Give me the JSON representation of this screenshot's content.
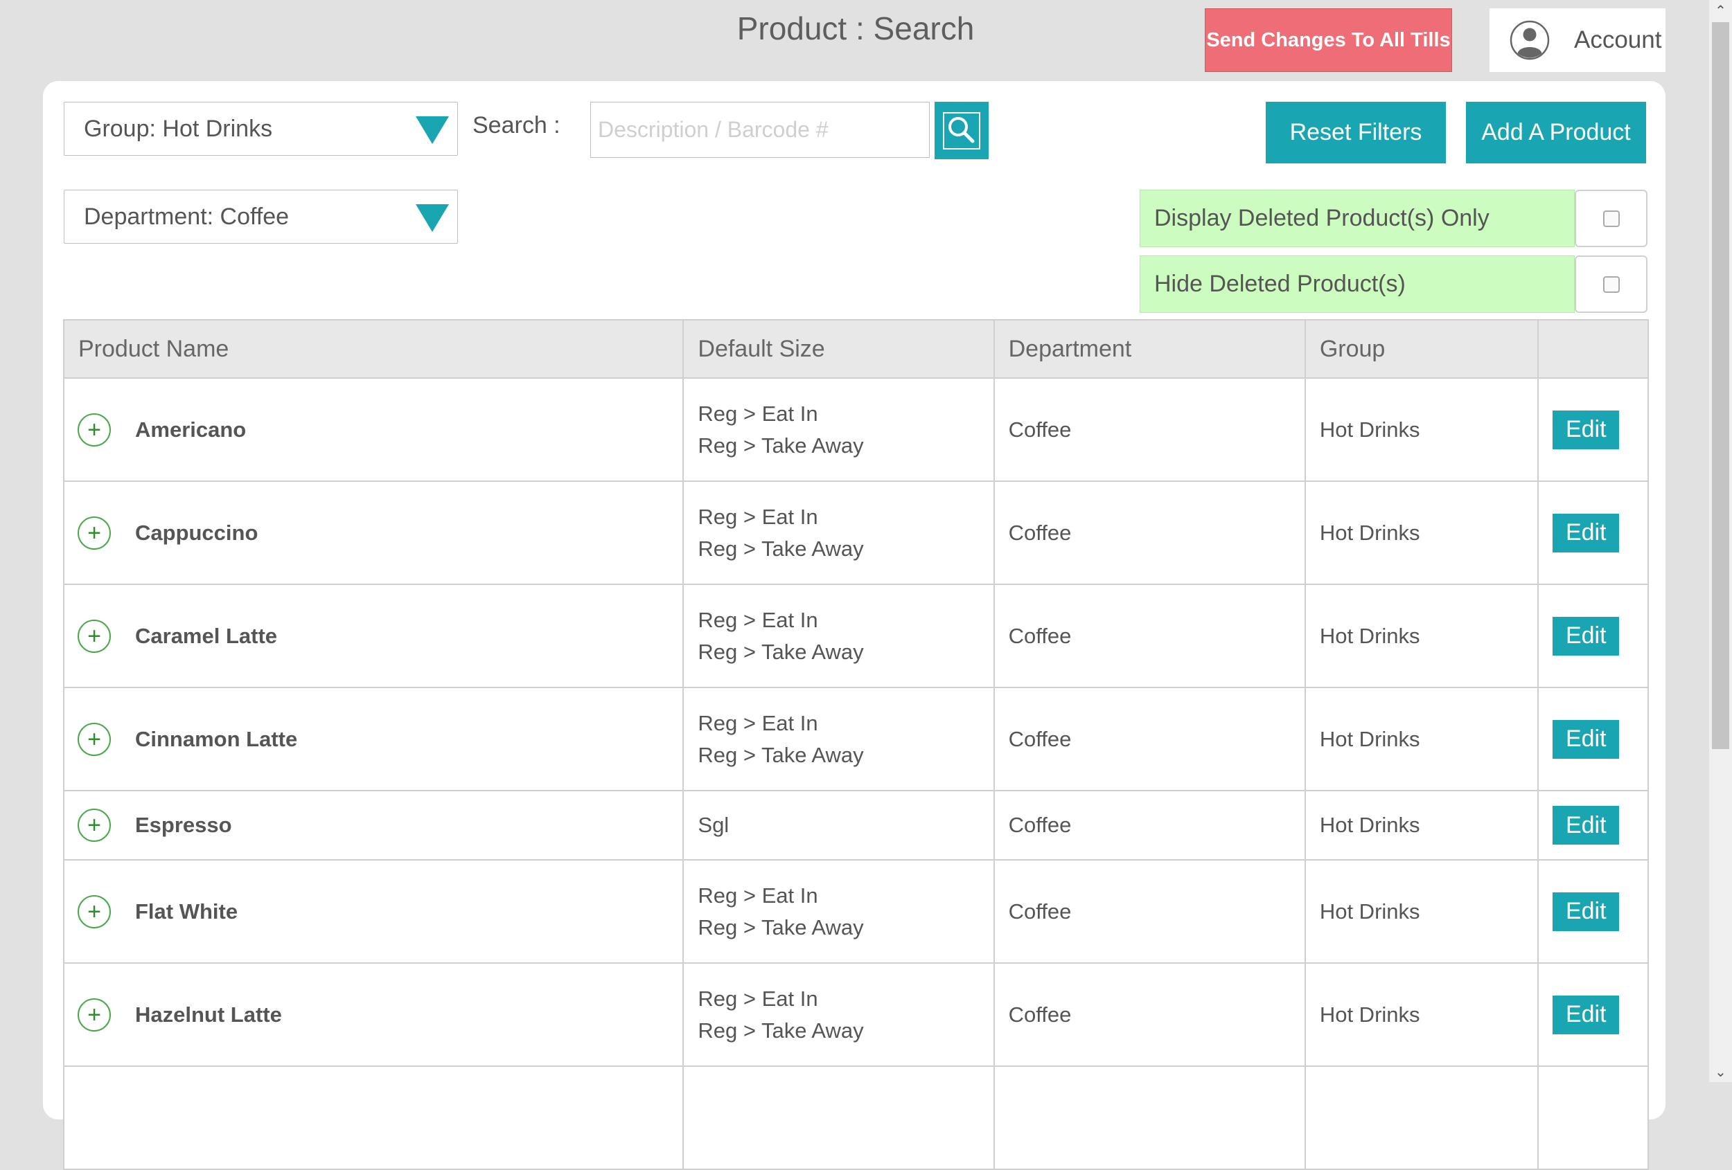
{
  "header": {
    "title": "Product : Search",
    "send_button": "Send Changes To All Tills",
    "account_label": "Account"
  },
  "filters": {
    "group_select": "Group: Hot Drinks",
    "department_select": "Department: Coffee",
    "search_label": "Search :",
    "search_placeholder": "Description / Barcode #",
    "reset_button": "Reset Filters",
    "add_button": "Add A Product",
    "display_deleted_label": "Display Deleted Product(s) Only",
    "hide_deleted_label": "Hide Deleted Product(s)",
    "display_deleted_checked": false,
    "hide_deleted_checked": false
  },
  "table": {
    "columns": [
      "Product Name",
      "Default Size",
      "Department",
      "Group",
      ""
    ],
    "edit_label": "Edit",
    "expand_symbol": "+",
    "rows": [
      {
        "name": "Americano",
        "sizes": [
          "Reg > Eat In",
          "Reg > Take Away"
        ],
        "department": "Coffee",
        "group": "Hot Drinks"
      },
      {
        "name": "Cappuccino",
        "sizes": [
          "Reg > Eat In",
          "Reg > Take Away"
        ],
        "department": "Coffee",
        "group": "Hot Drinks"
      },
      {
        "name": "Caramel Latte",
        "sizes": [
          "Reg > Eat In",
          "Reg > Take Away"
        ],
        "department": "Coffee",
        "group": "Hot Drinks"
      },
      {
        "name": "Cinnamon Latte",
        "sizes": [
          "Reg > Eat In",
          "Reg > Take Away"
        ],
        "department": "Coffee",
        "group": "Hot Drinks"
      },
      {
        "name": "Espresso",
        "sizes": [
          "Sgl"
        ],
        "department": "Coffee",
        "group": "Hot Drinks"
      },
      {
        "name": "Flat White",
        "sizes": [
          "Reg > Eat In",
          "Reg > Take Away"
        ],
        "department": "Coffee",
        "group": "Hot Drinks"
      },
      {
        "name": "Hazelnut Latte",
        "sizes": [
          "Reg > Eat In",
          "Reg > Take Away"
        ],
        "department": "Coffee",
        "group": "Hot Drinks"
      },
      {
        "name": "",
        "sizes": [
          ""
        ],
        "department": "",
        "group": ""
      }
    ]
  },
  "icons": {
    "search": "search-icon",
    "account": "user-circle-icon",
    "dropdown": "triangle-down-icon",
    "expand": "plus-circle-icon"
  },
  "colors": {
    "accent": "#19a6b2",
    "send_button": "#ee6d76",
    "filter_bg": "#ccfcbf",
    "expand_icon": "#4aa84a"
  }
}
